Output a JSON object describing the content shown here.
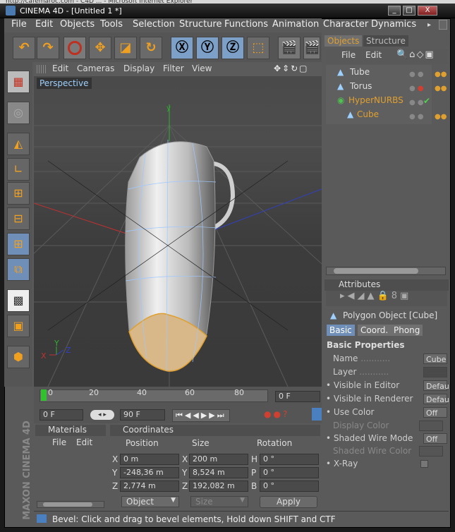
{
  "window": {
    "title": "CINEMA 4D - [Untitled 1 *]",
    "browser_strip": "http://cafemaroc.com - C4D ... - Microsoft Internet Explorer"
  },
  "menu": [
    "File",
    "Edit",
    "Objects",
    "Tools",
    "Selection",
    "Structure",
    "Functions",
    "Animation",
    "Character",
    "Dynamics"
  ],
  "viewport_menu": [
    "Edit",
    "Cameras",
    "Display",
    "Filter",
    "View"
  ],
  "viewport_label": "Perspective",
  "timeline": {
    "ticks": [
      "0",
      "20",
      "40",
      "60",
      "80"
    ],
    "current_frame": "0 F",
    "start": "0 F",
    "end": "90 F"
  },
  "objects_tabs": [
    "Objects",
    "Structure"
  ],
  "objects_menu": [
    "File",
    "Edit"
  ],
  "objects": [
    {
      "name": "Tube",
      "color": "#dddddd"
    },
    {
      "name": "Torus",
      "color": "#dddddd"
    },
    {
      "name": "HyperNURBS",
      "color": "#e0a030"
    },
    {
      "name": "Cube",
      "color": "#e0a030"
    }
  ],
  "attributes": {
    "header": "Attributes",
    "object_title": "Polygon Object [Cube]",
    "tabs": [
      "Basic",
      "Coord.",
      "Phong"
    ],
    "section": "Basic Properties",
    "rows": [
      {
        "label": "Name",
        "value": "Cube"
      },
      {
        "label": "Layer",
        "value": ""
      },
      {
        "label": "Visible in Editor",
        "value": "Defau"
      },
      {
        "label": "Visible in Renderer",
        "value": "Defau"
      },
      {
        "label": "Use Color",
        "value": "Off"
      },
      {
        "label": "Display Color",
        "value": ""
      },
      {
        "label": "Shaded Wire Mode",
        "value": "Off"
      },
      {
        "label": "Shaded Wire Color",
        "value": ""
      },
      {
        "label": "X-Ray",
        "value": ""
      }
    ]
  },
  "materials": {
    "header": "Materials",
    "menu": [
      "File",
      "Edit"
    ]
  },
  "coordinates": {
    "header": "Coordinates",
    "cols": [
      "Position",
      "Size",
      "Rotation"
    ],
    "rows": [
      {
        "axis": "X",
        "pos": "0 m",
        "saxis": "X",
        "size": "200 m",
        "raxis": "H",
        "rot": "0 °"
      },
      {
        "axis": "Y",
        "pos": "-248,36 m",
        "saxis": "Y",
        "size": "8,524 m",
        "raxis": "P",
        "rot": "0 °"
      },
      {
        "axis": "Z",
        "pos": "2,774 m",
        "saxis": "Z",
        "size": "192,082 m",
        "raxis": "B",
        "rot": "0 °"
      }
    ],
    "mode": "Object",
    "size_mode": "Size",
    "apply": "Apply"
  },
  "status": "Bevel: Click and drag to bevel elements, Hold down SHIFT and CTF",
  "branding": "MAXON CINEMA 4D"
}
